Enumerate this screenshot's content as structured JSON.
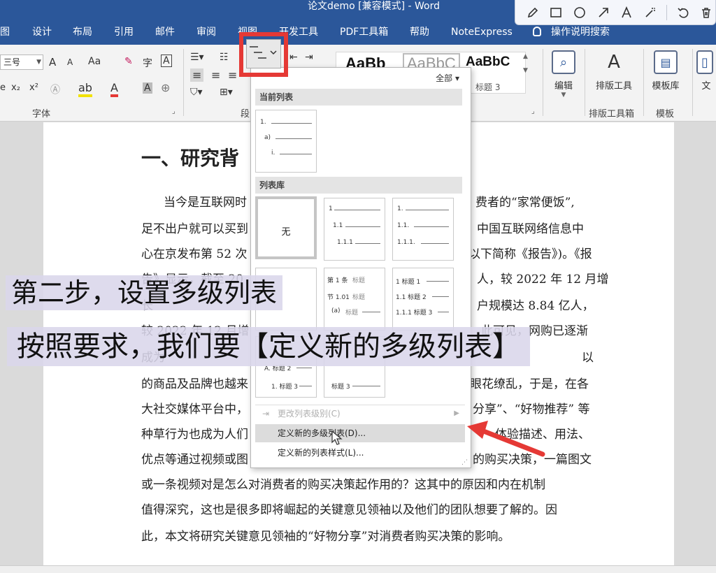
{
  "window": {
    "title": "论文demo [兼容模式] - Word"
  },
  "tabs": [
    {
      "label": "图"
    },
    {
      "label": "设计"
    },
    {
      "label": "布局"
    },
    {
      "label": "引用"
    },
    {
      "label": "邮件"
    },
    {
      "label": "审阅"
    },
    {
      "label": "视图"
    },
    {
      "label": "开发工具"
    },
    {
      "label": "PDF工具箱"
    },
    {
      "label": "帮助"
    },
    {
      "label": "NoteExpress"
    }
  ],
  "tell_me": "操作说明搜索",
  "ribbon": {
    "font_size": "三号",
    "grow_font": "A",
    "shrink_font": "A",
    "change_case": "Aa",
    "phonetic": "字",
    "border_char": "A",
    "subscript": "x₂",
    "superscript": "x²",
    "font_color": "A",
    "shade_char": "A",
    "font_group_label": "字体",
    "para_group_label": "段",
    "styles": [
      {
        "sample": "AaBb",
        "name": ""
      },
      {
        "sample": "AaBbC",
        "name": ""
      },
      {
        "sample": "AaBbC",
        "name": "标题 3"
      }
    ],
    "edit_label": "编辑",
    "typeset_label": "排版工具",
    "template_label": "模板库",
    "typeset_group_label": "排版工具箱",
    "template_group_label": "模板",
    "more_label": "文"
  },
  "document": {
    "heading": "一、研究背",
    "lines": [
      {
        "left": "当今是互联网时",
        "right": "费者的“家常便饭”,"
      },
      {
        "left": "足不出户就可以买到",
        "right": "中国互联网络信息中"
      },
      {
        "left": "心在京发布第 52 次",
        "right": "以下简称《报告》)。《报"
      },
      {
        "left": "告》显示，截至 20",
        "right": "人，较 2022 年 12 月增"
      },
      {
        "left": "长",
        "right": "户规模达 8.84 亿人，"
      },
      {
        "left": "较 2022 年 12 月增",
        "right": "此可见，网购已逐渐"
      },
      {
        "left": "成为",
        "right": "以"
      },
      {
        "left": "的商品及品牌也越来",
        "right": "眼花缭乱，于是，在各"
      },
      {
        "left": "大社交媒体平台中，",
        "right": "分享”、“好物推荐” 等"
      },
      {
        "left": "种草行为也成为人们",
        "right": "体验描述、用法、"
      },
      {
        "left": "优点等通过视频或图",
        "right": "的购买决策，一篇图文"
      },
      {
        "left": "或一条视频对是怎么对消费者的购买决策起作用的？这其中的原因和内在机制",
        "right": ""
      },
      {
        "left": "值得深究，这也是很多即将崛起的关键意见领袖以及他们的团队想要了解的。因",
        "right": ""
      },
      {
        "left": "此，本文将研究关键意见领袖的“好物分享”对消费者购买决策的影响。",
        "right": ""
      }
    ]
  },
  "dropdown": {
    "filter": "全部",
    "current_section": "当前列表",
    "library_section": "列表库",
    "none_label": "无",
    "list_labels": {
      "n1": "1.",
      "a": "a)",
      "i": "i.",
      "l1": "1",
      "l11": "1.1",
      "l111": "1.1.1",
      "l1d": "1.",
      "l11d": "1.1.",
      "l111d": "1.1.1.",
      "article": "第 1 条",
      "sec": "节 1.01",
      "para": "(a)",
      "h1": "1 标题 1",
      "h2": "1.1 标题 2",
      "h3": "1.1.1 标题 3",
      "heading_word": "标题",
      "row3_left_b": "A. 标题 2",
      "row3_left_c": "1. 标题 3",
      "row3_mid_c": "标题 3"
    },
    "menu": [
      {
        "label": "更改列表级别(C)",
        "disabled": true
      },
      {
        "label": "定义新的多级列表(D)...",
        "hover": true
      },
      {
        "label": "定义新的列表样式(L)..."
      }
    ]
  },
  "captions": {
    "step": "第二步，设置多级列表",
    "instruction": "按照要求，我们要【定义新的多级列表】"
  },
  "colors": {
    "word_blue": "#2b579a",
    "highlight_red": "#e53935",
    "caption_bg": "#dad6eb"
  }
}
